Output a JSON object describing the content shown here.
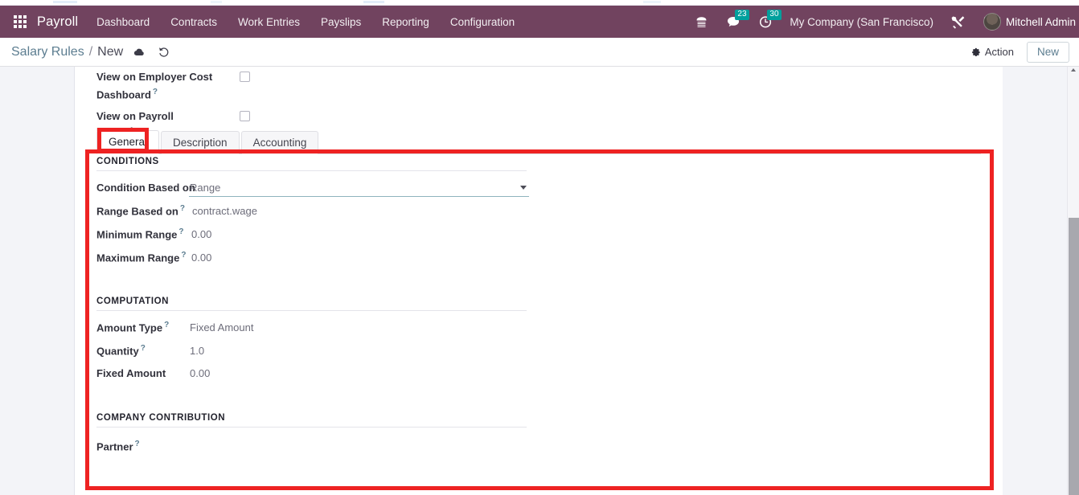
{
  "navbar": {
    "apps_icon": "apps-grid-icon",
    "brand": "Payroll",
    "menu": [
      {
        "label": "Dashboard"
      },
      {
        "label": "Contracts"
      },
      {
        "label": "Work Entries"
      },
      {
        "label": "Payslips"
      },
      {
        "label": "Reporting"
      },
      {
        "label": "Configuration"
      }
    ],
    "right": {
      "phone_icon": "telephone-icon",
      "messages_icon": "chat-bubble-icon",
      "messages_count": "23",
      "activities_icon": "clock-icon",
      "activities_count": "30",
      "company": "My Company (San Francisco)",
      "tools_icon": "wrench-screwdriver-icon",
      "user_name": "Mitchell Admin"
    },
    "colors": {
      "background": "#71435f",
      "badge": "#00a09d",
      "text": "#ffffff"
    }
  },
  "control_panel": {
    "breadcrumb_parent": "Salary Rules",
    "breadcrumb_separator": "/",
    "breadcrumb_current": "New",
    "save_icon": "cloud-save-icon",
    "discard_icon": "undo-discard-icon",
    "action_label": "Action",
    "action_icon": "gear-icon",
    "new_label": "New"
  },
  "form": {
    "top_fields": [
      {
        "label": "View on Employer Cost Dashboard",
        "help": "?",
        "checked": false
      },
      {
        "label": "View on Payroll Reporting",
        "help": "",
        "checked": false
      }
    ],
    "tabs": [
      {
        "label": "General",
        "active": true
      },
      {
        "label": "Description",
        "active": false
      },
      {
        "label": "Accounting",
        "active": false
      }
    ],
    "groups": [
      {
        "title": "CONDITIONS",
        "fields": [
          {
            "label": "Condition Based on",
            "help": "",
            "value": "Range",
            "type": "select"
          },
          {
            "label": "Range Based on",
            "help": "?",
            "value": "contract.wage",
            "type": "text"
          },
          {
            "label": "Minimum Range",
            "help": "?",
            "value": "0.00",
            "type": "text"
          },
          {
            "label": "Maximum Range",
            "help": "?",
            "value": "0.00",
            "type": "text"
          }
        ]
      },
      {
        "title": "COMPUTATION",
        "fields": [
          {
            "label": "Amount Type",
            "help": "?",
            "value": "Fixed Amount",
            "type": "text"
          },
          {
            "label": "Quantity",
            "help": "?",
            "value": "1.0",
            "type": "text"
          },
          {
            "label": "Fixed Amount",
            "help": "",
            "value": "0.00",
            "type": "text"
          }
        ]
      },
      {
        "title": "COMPANY CONTRIBUTION",
        "fields": [
          {
            "label": "Partner",
            "help": "?",
            "value": "",
            "type": "text"
          }
        ]
      }
    ]
  },
  "annotations": {
    "color": "#ee2222",
    "boxes": [
      {
        "name": "general-tab-highlight"
      },
      {
        "name": "general-tab-content-highlight"
      }
    ]
  },
  "scrollbar": {
    "orientation": "vertical",
    "position": "right"
  }
}
